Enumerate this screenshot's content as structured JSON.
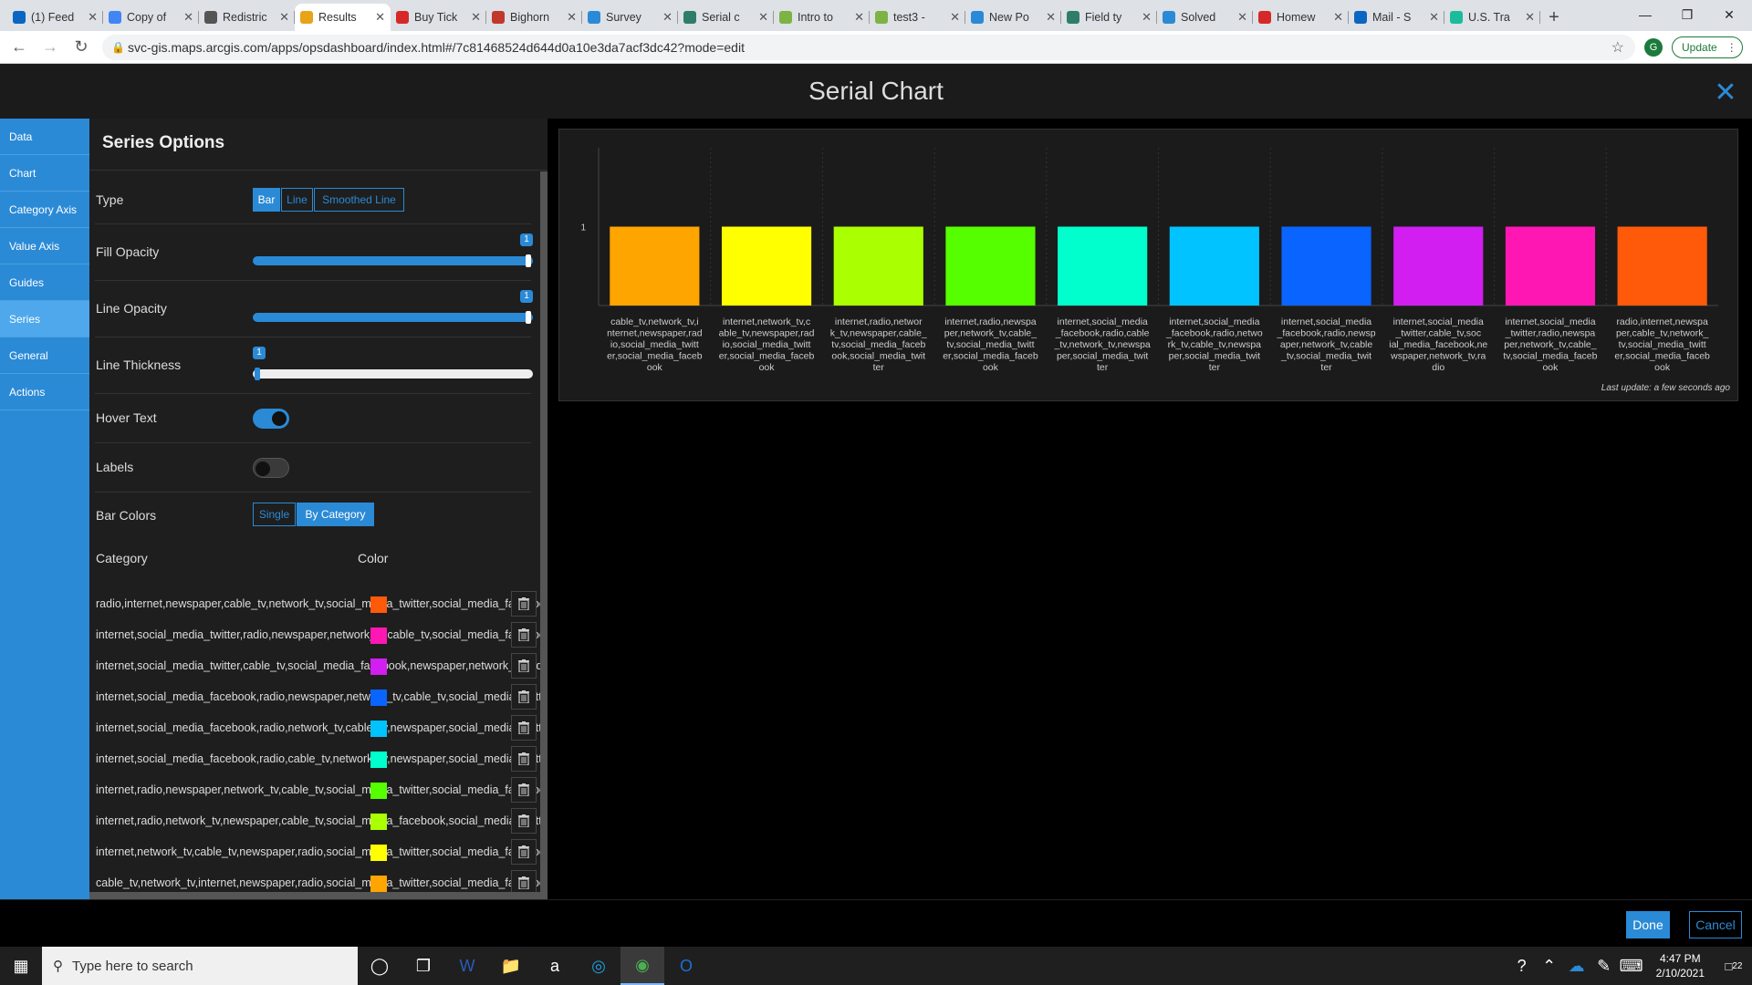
{
  "browser": {
    "tabs": [
      {
        "label": "(1) Feed",
        "icon_color": "#0a66c2",
        "icon": "linkedin-icon"
      },
      {
        "label": "Copy of",
        "icon_color": "#4285f4",
        "icon": "docs-icon"
      },
      {
        "label": "Redistric",
        "icon_color": "#555555",
        "icon": "globe-icon"
      },
      {
        "label": "Results",
        "icon_color": "#e8a317",
        "icon": "arcgis-icon",
        "active": true
      },
      {
        "label": "Buy Tick",
        "icon_color": "#d62828",
        "icon": "ticket-icon"
      },
      {
        "label": "Bighorn",
        "icon_color": "#c0392b",
        "icon": "canvas-icon"
      },
      {
        "label": "Survey",
        "icon_color": "#2b8ad6",
        "icon": "esri-icon"
      },
      {
        "label": "Serial c",
        "icon_color": "#2e7d6b",
        "icon": "esri-globe-icon"
      },
      {
        "label": "Intro to",
        "icon_color": "#7cb342",
        "icon": "d2l-icon"
      },
      {
        "label": "test3 -",
        "icon_color": "#7cb342",
        "icon": "d2l-icon"
      },
      {
        "label": "New Po",
        "icon_color": "#2b8ad6",
        "icon": "esri-icon"
      },
      {
        "label": "Field ty",
        "icon_color": "#2e7d6b",
        "icon": "esri-globe-icon"
      },
      {
        "label": "Solved",
        "icon_color": "#2b8ad6",
        "icon": "esri-icon"
      },
      {
        "label": "Homew",
        "icon_color": "#d62828",
        "icon": "help-icon"
      },
      {
        "label": "Mail - S",
        "icon_color": "#0a66c2",
        "icon": "outlook-icon"
      },
      {
        "label": "U.S. Tra",
        "icon_color": "#1abc9c",
        "icon": "dot-icon"
      }
    ],
    "url": "svc-gis.maps.arcgis.com/apps/opsdashboard/index.html#/7c81468524d644d0a10e3da7acf3dc42?mode=edit",
    "update_label": "Update",
    "profile_initial": "G"
  },
  "modal": {
    "title": "Serial Chart"
  },
  "nav": {
    "items": [
      "Data",
      "Chart",
      "Category Axis",
      "Value Axis",
      "Guides",
      "Series",
      "General",
      "Actions"
    ],
    "active_index": 5
  },
  "series_options": {
    "title": "Series Options",
    "type_label": "Type",
    "type_options": [
      "Bar",
      "Line",
      "Smoothed Line"
    ],
    "type_selected": "Bar",
    "fill_opacity_label": "Fill Opacity",
    "fill_opacity_value": "1",
    "line_opacity_label": "Line Opacity",
    "line_opacity_value": "1",
    "line_thickness_label": "Line Thickness",
    "line_thickness_value": "1",
    "hover_text_label": "Hover Text",
    "hover_text_on": true,
    "labels_label": "Labels",
    "labels_on": false,
    "bar_colors_label": "Bar Colors",
    "bar_colors_options": [
      "Single",
      "By Category"
    ],
    "bar_colors_selected": "By Category",
    "category_header": "Category",
    "color_header": "Color",
    "categories": [
      {
        "text": "radio,internet,newspaper,cable_tv,network_tv,social_media_twitter,social_media_facebook",
        "color": "#ff5a0a"
      },
      {
        "text": "internet,social_media_twitter,radio,newspaper,network_tv,cable_tv,social_media_facebook",
        "color": "#ff17b4"
      },
      {
        "text": "internet,social_media_twitter,cable_tv,social_media_facebook,newspaper,network_tv,radio",
        "color": "#d21ef0"
      },
      {
        "text": "internet,social_media_facebook,radio,newspaper,network_tv,cable_tv,social_media_twitter",
        "color": "#0a64ff"
      },
      {
        "text": "internet,social_media_facebook,radio,network_tv,cable_tv,newspaper,social_media_twitter",
        "color": "#00c3ff"
      },
      {
        "text": "internet,social_media_facebook,radio,cable_tv,network_tv,newspaper,social_media_twitter",
        "color": "#00ffcc"
      },
      {
        "text": "internet,radio,newspaper,network_tv,cable_tv,social_media_twitter,social_media_facebook",
        "color": "#55ff00"
      },
      {
        "text": "internet,radio,network_tv,newspaper,cable_tv,social_media_facebook,social_media_twitter",
        "color": "#aaff00"
      },
      {
        "text": "internet,network_tv,cable_tv,newspaper,radio,social_media_twitter,social_media_facebook",
        "color": "#ffff00"
      },
      {
        "text": "cable_tv,network_tv,internet,newspaper,radio,social_media_twitter,social_media_facebook",
        "color": "#ffa500"
      }
    ]
  },
  "chart_data": {
    "type": "bar",
    "categories": [
      "cable_tv,network_tv,internet,newspaper,radio,social_media_twitter,social_media_facebook",
      "internet,network_tv,cable_tv,newspaper,radio,social_media_twitter,social_media_facebook",
      "internet,radio,network_tv,newspaper,cable_tv,social_media_facebook,social_media_twitter",
      "internet,radio,newspaper,network_tv,cable_tv,social_media_twitter,social_media_facebook",
      "internet,social_media_facebook,radio,cable_tv,network_tv,newspaper,social_media_twitter",
      "internet,social_media_facebook,radio,network_tv,cable_tv,newspaper,social_media_twitter",
      "internet,social_media_facebook,radio,newspaper,network_tv,cable_tv,social_media_twitter",
      "internet,social_media_twitter,cable_tv,social_media_facebook,newspaper,network_tv,radio",
      "internet,social_media_twitter,radio,newspaper,network_tv,cable_tv,social_media_facebook",
      "radio,internet,newspaper,cable_tv,network_tv,social_media_twitter,social_media_facebook"
    ],
    "x_tick_labels": [
      [
        "cable_tv,network_tv,i",
        "nternet,newspaper,rad",
        "io,social_media_twitt",
        "er,social_media_faceb",
        "ook"
      ],
      [
        "internet,network_tv,c",
        "able_tv,newspaper,rad",
        "io,social_media_twitt",
        "er,social_media_faceb",
        "ook"
      ],
      [
        "internet,radio,networ",
        "k_tv,newspaper,cable_",
        "tv,social_media_faceb",
        "ook,social_media_twit",
        "ter"
      ],
      [
        "internet,radio,newspa",
        "per,network_tv,cable_",
        "tv,social_media_twitt",
        "er,social_media_faceb",
        "ook"
      ],
      [
        "internet,social_media",
        "_facebook,radio,cable",
        "_tv,network_tv,newspa",
        "per,social_media_twit",
        "ter"
      ],
      [
        "internet,social_media",
        "_facebook,radio,netwo",
        "rk_tv,cable_tv,newspa",
        "per,social_media_twit",
        "ter"
      ],
      [
        "internet,social_media",
        "_facebook,radio,newsp",
        "aper,network_tv,cable",
        "_tv,social_media_twit",
        "ter"
      ],
      [
        "internet,social_media",
        "_twitter,cable_tv,soc",
        "ial_media_facebook,ne",
        "wspaper,network_tv,ra",
        "dio"
      ],
      [
        "internet,social_media",
        "_twitter,radio,newspa",
        "per,network_tv,cable_",
        "tv,social_media_faceb",
        "ook"
      ],
      [
        "radio,internet,newspa",
        "per,cable_tv,network_",
        "tv,social_media_twitt",
        "er,social_media_faceb",
        "ook"
      ]
    ],
    "values": [
      1,
      1,
      1,
      1,
      1,
      1,
      1,
      1,
      1,
      1
    ],
    "colors": [
      "#ffa500",
      "#ffff00",
      "#aaff00",
      "#55ff00",
      "#00ffcc",
      "#00c3ff",
      "#0a64ff",
      "#d21ef0",
      "#ff17b4",
      "#ff5a0a"
    ],
    "y_ticks": [
      1
    ],
    "ylim": [
      0,
      2
    ],
    "grid": true,
    "last_update": "Last update: a few seconds ago"
  },
  "footer": {
    "done_label": "Done",
    "cancel_label": "Cancel"
  },
  "taskbar": {
    "search_placeholder": "Type here to search",
    "time": "4:47 PM",
    "date": "2/10/2021",
    "notification_count": "22"
  }
}
